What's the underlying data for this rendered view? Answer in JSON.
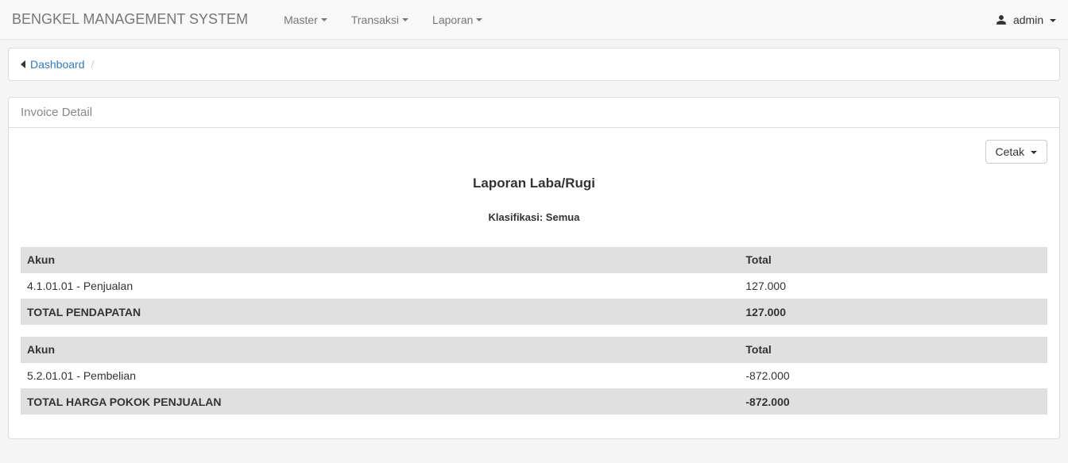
{
  "navbar": {
    "brand": "BENGKEL MANAGEMENT SYSTEM",
    "menus": [
      {
        "label": "Master"
      },
      {
        "label": "Transaksi"
      },
      {
        "label": "Laporan"
      }
    ],
    "user": "admin"
  },
  "breadcrumb": {
    "dashboard": "Dashboard"
  },
  "panel": {
    "heading": "Invoice Detail",
    "print_label": "Cetak",
    "report_title": "Laporan Laba/Rugi",
    "report_subtitle": "Klasifikasi: Semua"
  },
  "tables": [
    {
      "header_akun": "Akun",
      "header_total": "Total",
      "rows": [
        {
          "akun": "4.1.01.01 - Penjualan",
          "total": "127.000"
        }
      ],
      "total_label": "TOTAL PENDAPATAN",
      "total_value": "127.000"
    },
    {
      "header_akun": "Akun",
      "header_total": "Total",
      "rows": [
        {
          "akun": "5.2.01.01 - Pembelian",
          "total": "-872.000"
        }
      ],
      "total_label": "TOTAL HARGA POKOK PENJUALAN",
      "total_value": "-872.000"
    }
  ]
}
